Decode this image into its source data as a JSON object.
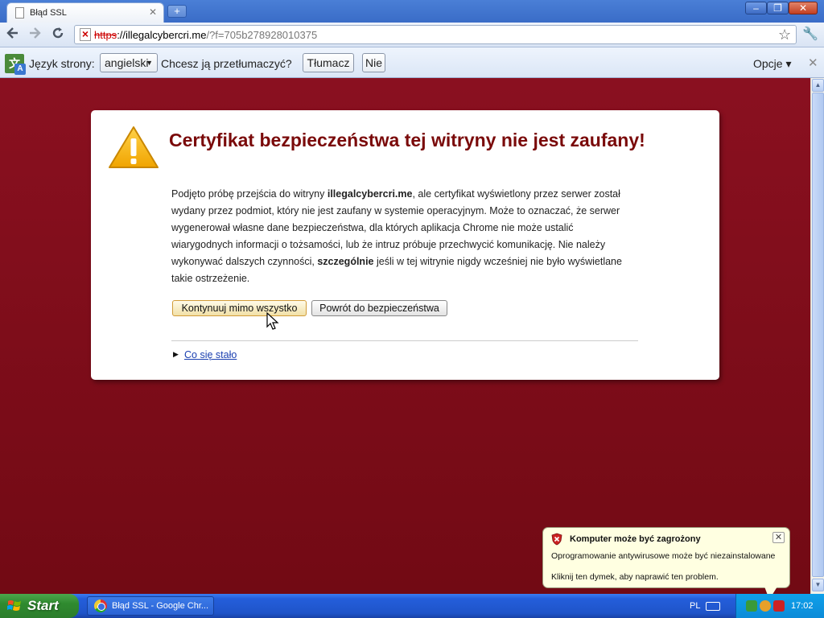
{
  "window": {
    "tab_title": "Błąd SSL",
    "new_tab_symbol": "+",
    "minimize": "‒",
    "maximize": "❐",
    "close": "✕"
  },
  "toolbar": {
    "url_scheme": "https",
    "url_host": "://illegalcybercri.me",
    "url_rest": "/?f=705b278928010375"
  },
  "translate_bar": {
    "page_language_label": "Język strony:",
    "selected_language": "angielski",
    "question": "Chcesz ją przetłumaczyć?",
    "translate_button": "Tłumacz",
    "no_button": "Nie",
    "options_menu": "Opcje ▾",
    "close": "✕"
  },
  "interstitial": {
    "heading": "Certyfikat bezpieczeństwa tej witryny nie jest zaufany!",
    "body_before_site": "Podjęto próbę przejścia do witryny ",
    "site_name": "illegalcybercri.me",
    "body_middle": ", ale certyfikat wyświetlony przez serwer został wydany przez podmiot, który nie jest zaufany w systemie operacyjnym. Może to oznaczać, że serwer wygenerował własne dane bezpieczeństwa, dla których aplikacja Chrome nie może ustalić wiarygodnych informacji o tożsamości, lub że intruz próbuje przechwycić komunikację. Nie należy wykonywać dalszych czynności, ",
    "emphasis": "szczególnie",
    "body_after": " jeśli w tej witrynie nigdy wcześniej nie było wyświetlane takie ostrzeżenie.",
    "proceed_button": "Kontynuuj mimo wszystko",
    "back_button": "Powrót do bezpieczeństwa",
    "what_happened_link": "Co się stało"
  },
  "balloon": {
    "title": "Komputer może być zagrożony",
    "line1": "Oprogramowanie antywirusowe może być niezainstalowane",
    "line2": "Kliknij ten dymek, aby naprawić ten problem.",
    "close": "✕"
  },
  "taskbar": {
    "start_label": "Start",
    "task_item": "Błąd SSL - Google Chr...",
    "language": "PL",
    "clock": "17:02"
  },
  "colors": {
    "background": "#7b0c18",
    "heading": "#7a0a0a",
    "link": "#1a3fb0"
  }
}
